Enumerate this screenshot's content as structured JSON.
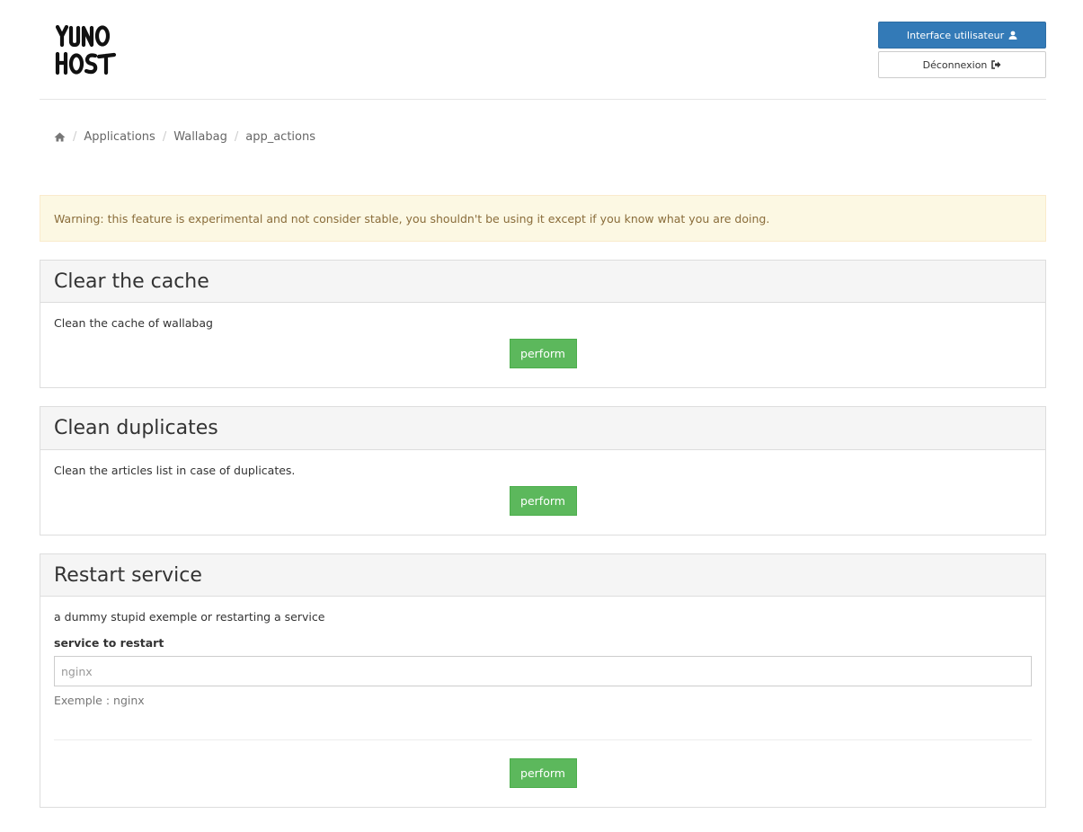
{
  "header": {
    "logo_text_line1": "YUNO",
    "logo_text_line2": "HOST",
    "user_interface_label": "Interface utilisateur",
    "logout_label": "Déconnexion"
  },
  "breadcrumb": {
    "items": [
      "Applications",
      "Wallabag",
      "app_actions"
    ]
  },
  "warning": "Warning: this feature is experimental and not consider stable, you shouldn't be using it except if you know what you are doing.",
  "actions": [
    {
      "title": "Clear the cache",
      "description": "Clean the cache of wallabag",
      "button": "perform"
    },
    {
      "title": "Clean duplicates",
      "description": "Clean the articles list in case of duplicates.",
      "button": "perform"
    },
    {
      "title": "Restart service",
      "description": "a dummy stupid exemple or restarting a service",
      "field_label": "service to restart",
      "field_placeholder": "nginx",
      "field_help": "Exemple : nginx",
      "button": "perform"
    }
  ],
  "colors": {
    "primary": "#337ab7",
    "success": "#5cb85c",
    "warning_bg": "#fcf8e3",
    "warning_text": "#8a6d3b"
  }
}
